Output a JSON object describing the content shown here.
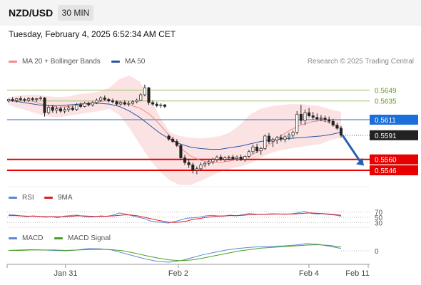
{
  "header": {
    "pair": "NZD/USD",
    "timeframe": "30 MIN"
  },
  "datetime": "Tuesday, February 4, 2025 6:52:34 AM CET",
  "legend_main": [
    {
      "label": "MA 20 + Bollinger Bands",
      "color": "#f08c8c"
    },
    {
      "label": "MA 50",
      "color": "#2a55a5"
    }
  ],
  "credit": "Research © 2025 Trading Central",
  "legend_rsi": [
    {
      "label": "RSI",
      "color": "#5b86d6"
    },
    {
      "label": "9MA",
      "color": "#e02020"
    }
  ],
  "legend_macd": [
    {
      "label": "MACD",
      "color": "#5b86d6"
    },
    {
      "label": "MACD Signal",
      "color": "#4aa020"
    }
  ],
  "price_levels": {
    "resistance_2": "0.5649",
    "resistance_1": "0.5635",
    "pivot": "0.5611",
    "last": "0.5591",
    "support_1": "0.5560",
    "support_2": "0.5546"
  },
  "rsi_levels": [
    "70",
    "50",
    "30"
  ],
  "macd_zero": "0",
  "x_labels": [
    "Jan 31",
    "Feb 2",
    "Feb 4",
    "Feb 11"
  ],
  "chart_data": {
    "type": "candlestick",
    "y_range": [
      0.5525,
      0.5675
    ],
    "candles": [
      [
        0.5635,
        0.5638,
        0.5633,
        0.5637
      ],
      [
        0.5637,
        0.564,
        0.5634,
        0.5636
      ],
      [
        0.5636,
        0.5639,
        0.5633,
        0.5638
      ],
      [
        0.5638,
        0.5641,
        0.5635,
        0.5637
      ],
      [
        0.5637,
        0.5639,
        0.5634,
        0.5636
      ],
      [
        0.5636,
        0.564,
        0.5634,
        0.5638
      ],
      [
        0.5638,
        0.564,
        0.5635,
        0.5637
      ],
      [
        0.5637,
        0.5639,
        0.5634,
        0.5638
      ],
      [
        0.5638,
        0.5641,
        0.5636,
        0.5639
      ],
      [
        0.5639,
        0.564,
        0.5615,
        0.562
      ],
      [
        0.562,
        0.563,
        0.5618,
        0.5627
      ],
      [
        0.5627,
        0.563,
        0.562,
        0.5623
      ],
      [
        0.5623,
        0.5628,
        0.5619,
        0.5625
      ],
      [
        0.5625,
        0.5628,
        0.562,
        0.5622
      ],
      [
        0.5622,
        0.5627,
        0.5619,
        0.5624
      ],
      [
        0.5624,
        0.563,
        0.5621,
        0.5626
      ],
      [
        0.5626,
        0.5629,
        0.5622,
        0.5624
      ],
      [
        0.5624,
        0.5632,
        0.5622,
        0.563
      ],
      [
        0.563,
        0.5633,
        0.5626,
        0.5628
      ],
      [
        0.5628,
        0.5634,
        0.5627,
        0.5632
      ],
      [
        0.5632,
        0.5634,
        0.5628,
        0.563
      ],
      [
        0.563,
        0.5635,
        0.5628,
        0.5633
      ],
      [
        0.5633,
        0.5638,
        0.5631,
        0.5636
      ],
      [
        0.5636,
        0.5641,
        0.5634,
        0.5639
      ],
      [
        0.5639,
        0.5642,
        0.5635,
        0.5637
      ],
      [
        0.5637,
        0.5639,
        0.5633,
        0.5635
      ],
      [
        0.5635,
        0.5638,
        0.5632,
        0.5634
      ],
      [
        0.5634,
        0.5636,
        0.5629,
        0.5631
      ],
      [
        0.5631,
        0.5635,
        0.5629,
        0.5633
      ],
      [
        0.5633,
        0.5636,
        0.5629,
        0.5631
      ],
      [
        0.5631,
        0.5635,
        0.5628,
        0.5632
      ],
      [
        0.5632,
        0.5636,
        0.563,
        0.5634
      ],
      [
        0.5634,
        0.5638,
        0.5632,
        0.5636
      ],
      [
        0.5636,
        0.5645,
        0.5635,
        0.5643
      ],
      [
        0.5643,
        0.5656,
        0.5641,
        0.5652
      ],
      [
        0.5652,
        0.5653,
        0.563,
        0.5633
      ],
      [
        0.5633,
        0.5636,
        0.5629,
        0.5631
      ],
      [
        0.5631,
        0.5634,
        0.5627,
        0.5629
      ],
      [
        0.5629,
        0.5632,
        0.5626,
        0.563
      ],
      [
        0.563,
        0.5631,
        0.5626,
        0.5628
      ],
      [
        0.559,
        0.5592,
        0.5584,
        0.5586
      ],
      [
        0.5586,
        0.5589,
        0.5581,
        0.5583
      ],
      [
        0.5583,
        0.5586,
        0.5576,
        0.5578
      ],
      [
        0.5578,
        0.558,
        0.556,
        0.5562
      ],
      [
        0.5562,
        0.5566,
        0.5553,
        0.5556
      ],
      [
        0.5556,
        0.5561,
        0.5549,
        0.5553
      ],
      [
        0.5553,
        0.5556,
        0.5542,
        0.5546
      ],
      [
        0.5546,
        0.5551,
        0.5541,
        0.5548
      ],
      [
        0.5548,
        0.5556,
        0.5546,
        0.5553
      ],
      [
        0.5553,
        0.5557,
        0.555,
        0.5555
      ],
      [
        0.5555,
        0.5559,
        0.5552,
        0.5557
      ],
      [
        0.5557,
        0.5562,
        0.5554,
        0.556
      ],
      [
        0.556,
        0.5565,
        0.5557,
        0.5563
      ],
      [
        0.5563,
        0.5566,
        0.5558,
        0.556
      ],
      [
        0.556,
        0.5564,
        0.5557,
        0.5562
      ],
      [
        0.5562,
        0.5565,
        0.5559,
        0.5563
      ],
      [
        0.5563,
        0.5566,
        0.5559,
        0.5561
      ],
      [
        0.5561,
        0.5565,
        0.5558,
        0.5563
      ],
      [
        0.5563,
        0.5566,
        0.5558,
        0.556
      ],
      [
        0.556,
        0.5565,
        0.5557,
        0.5564
      ],
      [
        0.5564,
        0.5572,
        0.5562,
        0.557
      ],
      [
        0.557,
        0.5579,
        0.5567,
        0.5576
      ],
      [
        0.5576,
        0.558,
        0.5568,
        0.5571
      ],
      [
        0.5571,
        0.5576,
        0.5566,
        0.5574
      ],
      [
        0.5574,
        0.5592,
        0.5572,
        0.559
      ],
      [
        0.559,
        0.5594,
        0.558,
        0.5583
      ],
      [
        0.5583,
        0.5588,
        0.5576,
        0.5585
      ],
      [
        0.5585,
        0.559,
        0.558,
        0.5588
      ],
      [
        0.5588,
        0.5592,
        0.5583,
        0.5586
      ],
      [
        0.5586,
        0.5591,
        0.5582,
        0.5589
      ],
      [
        0.5589,
        0.5594,
        0.5585,
        0.5591
      ],
      [
        0.5591,
        0.5597,
        0.5588,
        0.5595
      ],
      [
        0.5595,
        0.5622,
        0.5592,
        0.5618
      ],
      [
        0.5618,
        0.563,
        0.5605,
        0.561
      ],
      [
        0.561,
        0.5624,
        0.5604,
        0.562
      ],
      [
        0.562,
        0.5626,
        0.5614,
        0.5616
      ],
      [
        0.5616,
        0.5621,
        0.5611,
        0.5614
      ],
      [
        0.5614,
        0.5619,
        0.561,
        0.5612
      ],
      [
        0.5612,
        0.5617,
        0.5609,
        0.5613
      ],
      [
        0.5613,
        0.5616,
        0.5608,
        0.5611
      ],
      [
        0.5611,
        0.5615,
        0.5606,
        0.5609
      ],
      [
        0.5609,
        0.5612,
        0.5602,
        0.5604
      ],
      [
        0.5604,
        0.5607,
        0.5598,
        0.56
      ],
      [
        0.56,
        0.5603,
        0.5588,
        0.5591
      ]
    ],
    "ma20": [
      0.5636,
      0.5636,
      0.5636,
      0.5632,
      0.5629,
      0.5627,
      0.5628,
      0.563,
      0.5632,
      0.5634,
      0.5636,
      0.5634,
      0.563,
      0.5626,
      0.5618,
      0.5605,
      0.559,
      0.5575,
      0.5565,
      0.5559,
      0.5556,
      0.5556,
      0.5558,
      0.5561,
      0.5565,
      0.5572,
      0.558,
      0.559,
      0.5598,
      0.5604,
      0.5608,
      0.561,
      0.5607,
      0.56
    ],
    "ma50": [
      0.5636,
      0.5634,
      0.5632,
      0.563,
      0.5629,
      0.5629,
      0.563,
      0.5631,
      0.5632,
      0.5632,
      0.5631,
      0.5628,
      0.5622,
      0.5614,
      0.5604,
      0.5594,
      0.5586,
      0.558,
      0.5576,
      0.5574,
      0.5573,
      0.5573,
      0.5575,
      0.5577,
      0.558,
      0.5583,
      0.5585,
      0.5586,
      0.5587,
      0.5588,
      0.5589,
      0.559,
      0.5592,
      0.5595
    ],
    "bb_upper": [
      0.564,
      0.5642,
      0.5643,
      0.5643,
      0.5641,
      0.564,
      0.5641,
      0.5644,
      0.5645,
      0.5647,
      0.5652,
      0.5663,
      0.5668,
      0.566,
      0.564,
      0.5615,
      0.5595,
      0.559,
      0.5588,
      0.5587,
      0.5588,
      0.559,
      0.5595,
      0.5605,
      0.5618,
      0.5625,
      0.5628,
      0.563,
      0.5631,
      0.5631,
      0.563,
      0.5628,
      0.5624,
      0.5621
    ],
    "bb_lower": [
      0.563,
      0.5626,
      0.5622,
      0.5618,
      0.5615,
      0.5614,
      0.5616,
      0.5618,
      0.562,
      0.5622,
      0.5625,
      0.5617,
      0.56,
      0.558,
      0.556,
      0.5545,
      0.5533,
      0.5527,
      0.5527,
      0.5532,
      0.5538,
      0.5544,
      0.5548,
      0.5551,
      0.5555,
      0.5562,
      0.5568,
      0.5572,
      0.5574,
      0.5576,
      0.5578,
      0.558,
      0.5585,
      0.5588
    ],
    "rsi": [
      60,
      58,
      55,
      52,
      55,
      53,
      50,
      52,
      48,
      54,
      56,
      58,
      54,
      50,
      52,
      55,
      53,
      58,
      66,
      62,
      56,
      50,
      45,
      36,
      33,
      30,
      28,
      34,
      40,
      46,
      48,
      50,
      55,
      57,
      55,
      54,
      58,
      55,
      60,
      64,
      62,
      60,
      62,
      63,
      62,
      61,
      63,
      66,
      72,
      65,
      62,
      64,
      60,
      58,
      54
    ],
    "rsi_ma": [
      56,
      56,
      55,
      54,
      54,
      53,
      52,
      52,
      52,
      52,
      53,
      55,
      55,
      54,
      53,
      53,
      54,
      55,
      57,
      59,
      58,
      55,
      50,
      45,
      40,
      35,
      31,
      30,
      32,
      36,
      42,
      45,
      49,
      52,
      54,
      55,
      56,
      56,
      57,
      59,
      60,
      61,
      61,
      62,
      62,
      62,
      62,
      63,
      65,
      66,
      65,
      64,
      62,
      60,
      57
    ],
    "macd": [
      0.0001,
      0.0002,
      0.0003,
      0.0002,
      0.0001,
      0.0,
      0.0002,
      0.0006,
      0.0005,
      0.0002,
      -0.0006,
      -0.0014,
      -0.0022,
      -0.0028,
      -0.003,
      -0.0026,
      -0.0018,
      -0.001,
      -0.0004,
      0.0002,
      0.0006,
      0.0009,
      0.0011,
      0.0012,
      0.0013,
      0.0015,
      0.0019,
      0.0017,
      0.0012,
      0.0006
    ],
    "macd_signal": [
      0.0001,
      0.0001,
      0.0002,
      0.0002,
      0.0002,
      0.0001,
      0.0002,
      0.0003,
      0.0004,
      0.0003,
      0.0,
      -0.0006,
      -0.0013,
      -0.0019,
      -0.0024,
      -0.0026,
      -0.0024,
      -0.0019,
      -0.0013,
      -0.0007,
      -0.0001,
      0.0003,
      0.0007,
      0.0009,
      0.0011,
      0.0013,
      0.0015,
      0.0016,
      0.0014,
      0.001
    ],
    "forecast_arrow": {
      "from": 0.5591,
      "to": 0.5552
    }
  }
}
